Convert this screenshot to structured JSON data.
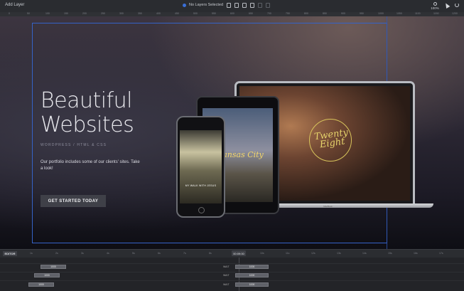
{
  "toolbar": {
    "add_layer": "Add Layer",
    "selection": "No Layers Selected",
    "zoom_label": "100%",
    "icons": [
      "copy-icon",
      "delete-icon",
      "lock-icon",
      "visibility-icon",
      "undo-small-icon",
      "redo-small-icon"
    ]
  },
  "ruler": {
    "ticks": [
      "0",
      "50",
      "100",
      "150",
      "200",
      "250",
      "300",
      "350",
      "400",
      "450",
      "500",
      "550",
      "600",
      "650",
      "700",
      "750",
      "800",
      "850",
      "900",
      "950",
      "1000",
      "1050",
      "1100",
      "1150",
      "1200"
    ]
  },
  "hero": {
    "title_line1": "Beautiful",
    "title_line2": "Websites",
    "subtitle": "WORDPRESS / HTML & CSS",
    "description": "Our portfolio includes some of our clients' sites. Take a look!",
    "button": "GET STARTED TODAY"
  },
  "devices": {
    "laptop_script": "Twenty Eight",
    "laptop_brand": "MacBook",
    "tablet_text": "Kansas City",
    "phone_text": "MY WALK WITH JESUS"
  },
  "timeline": {
    "editor_label": "EDITOR",
    "current_time": "00:09:00",
    "ticks": [
      "1s",
      "2s",
      "3s",
      "4s",
      "5s",
      "6s",
      "7s",
      "8s",
      "9s",
      "10s",
      "11s",
      "12s",
      "13s",
      "14s",
      "15s",
      "16s",
      "17s"
    ],
    "rows": [
      {
        "start_label": "1000",
        "wait": "WAIT",
        "end_label": "1000"
      },
      {
        "start_label": "1000",
        "wait": "WAIT",
        "end_label": "1000"
      },
      {
        "start_label": "1000",
        "wait": "WAIT",
        "end_label": "1000"
      }
    ]
  },
  "colors": {
    "guide": "#3563c8",
    "accent_gold": "#e6d36b",
    "button_bg": "#3f4048"
  }
}
